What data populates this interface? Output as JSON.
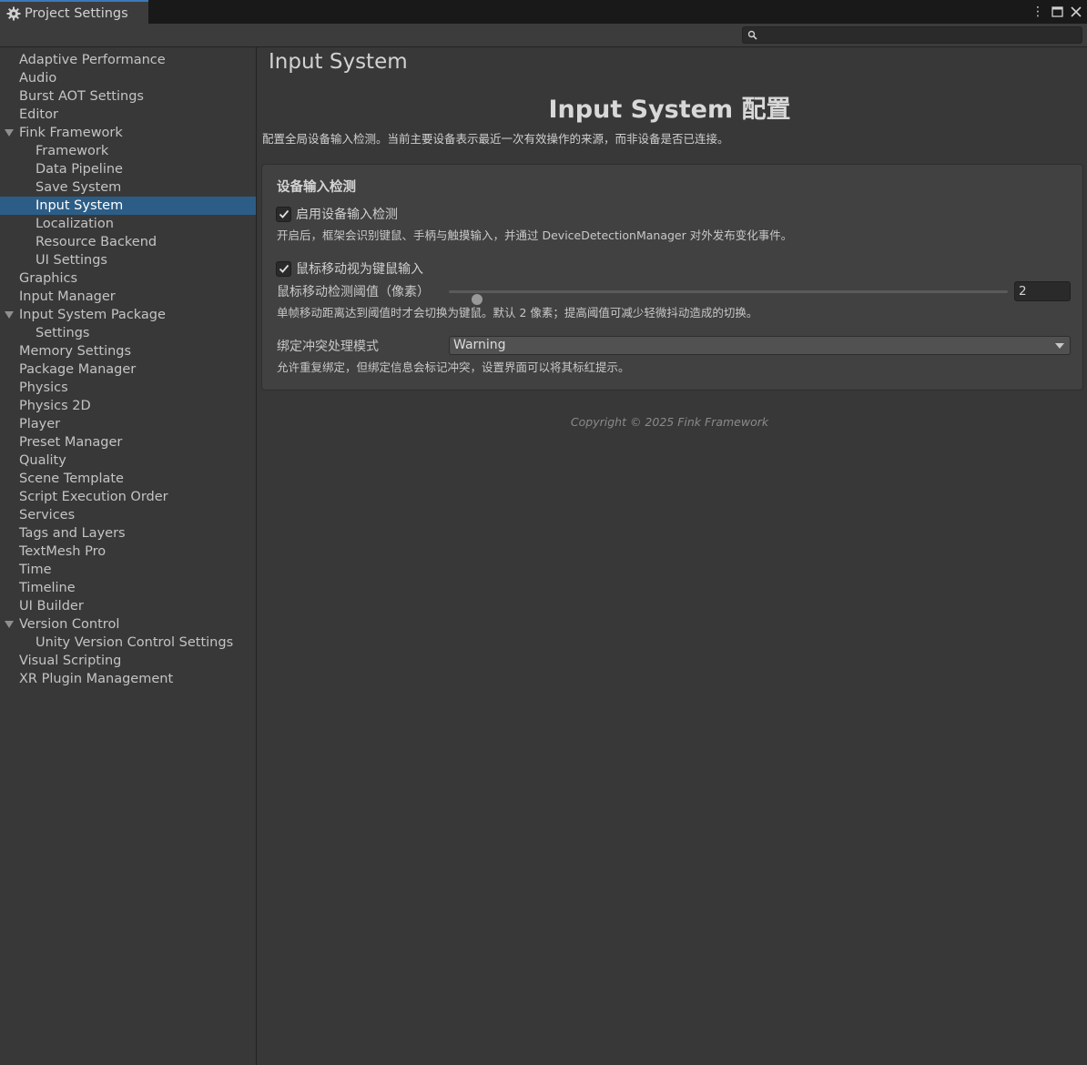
{
  "window": {
    "tab_title": "Project Settings",
    "menu_icon": "kebab-menu-icon",
    "maximize_icon": "maximize-icon",
    "close_icon": "close-icon"
  },
  "search": {
    "placeholder": "",
    "value": ""
  },
  "sidebar": {
    "items": [
      {
        "label": "Adaptive Performance"
      },
      {
        "label": "Audio"
      },
      {
        "label": "Burst AOT Settings"
      },
      {
        "label": "Editor"
      },
      {
        "label": "Fink Framework"
      },
      {
        "label": "Framework"
      },
      {
        "label": "Data Pipeline"
      },
      {
        "label": "Save System"
      },
      {
        "label": "Input System"
      },
      {
        "label": "Localization"
      },
      {
        "label": "Resource Backend"
      },
      {
        "label": "UI Settings"
      },
      {
        "label": "Graphics"
      },
      {
        "label": "Input Manager"
      },
      {
        "label": "Input System Package"
      },
      {
        "label": "Settings"
      },
      {
        "label": "Memory Settings"
      },
      {
        "label": "Package Manager"
      },
      {
        "label": "Physics"
      },
      {
        "label": "Physics 2D"
      },
      {
        "label": "Player"
      },
      {
        "label": "Preset Manager"
      },
      {
        "label": "Quality"
      },
      {
        "label": "Scene Template"
      },
      {
        "label": "Script Execution Order"
      },
      {
        "label": "Services"
      },
      {
        "label": "Tags and Layers"
      },
      {
        "label": "TextMesh Pro"
      },
      {
        "label": "Time"
      },
      {
        "label": "Timeline"
      },
      {
        "label": "UI Builder"
      },
      {
        "label": "Version Control"
      },
      {
        "label": "Unity Version Control Settings"
      },
      {
        "label": "Visual Scripting"
      },
      {
        "label": "XR Plugin Management"
      }
    ],
    "selected": "Input System"
  },
  "main": {
    "page_title": "Input System",
    "header_title": "Input System 配置",
    "subtitle": "配置全局设备输入检测。当前主要设备表示最近一次有效操作的来源，而非设备是否已连接。",
    "section": {
      "title": "设备输入检测",
      "enable_detection": {
        "label": "启用设备输入检测",
        "checked": true,
        "help": "开启后，框架会识别键鼠、手柄与触摸输入，并通过 DeviceDetectionManager 对外发布变化事件。"
      },
      "mouse_as_kbm": {
        "label": "鼠标移动视为键鼠输入",
        "checked": true
      },
      "threshold": {
        "label": "鼠标移动检测阈值（像素）",
        "value": "2",
        "slider_fraction": 0.05,
        "help": "单帧移动距离达到阈值时才会切换为键鼠。默认 2 像素；提高阈值可减少轻微抖动造成的切换。"
      },
      "conflict_mode": {
        "label": "绑定冲突处理模式",
        "value": "Warning",
        "help": "允许重复绑定，但绑定信息会标记冲突，设置界面可以将其标红提示。"
      }
    },
    "copyright": "Copyright © 2025 Fink Framework"
  },
  "colors": {
    "selection": "#2c5d87",
    "tab_accent": "#3a79bb",
    "background": "#383838",
    "panel": "#414141"
  }
}
